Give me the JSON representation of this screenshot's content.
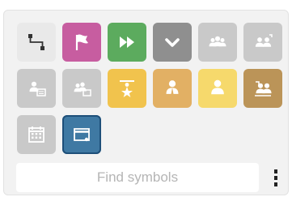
{
  "symbols": [
    {
      "name": "sequence-flow",
      "color": "#e9e9e9",
      "icon": "connector-icon"
    },
    {
      "name": "start-flag",
      "color": "#c75da0",
      "icon": "flag-icon"
    },
    {
      "name": "fast-forward",
      "color": "#5cab5e",
      "icon": "fast-forward-icon"
    },
    {
      "name": "decision",
      "color": "#8f8f8f",
      "icon": "chevron-down-icon"
    },
    {
      "name": "group",
      "color": "#c9c9c9",
      "icon": "users-icon"
    },
    {
      "name": "group-external",
      "color": "#c9c9c9",
      "icon": "users-external-icon"
    },
    {
      "name": "user-document",
      "color": "#c9c9c9",
      "icon": "user-document-icon"
    },
    {
      "name": "user-group-document",
      "color": "#c9c9c9",
      "icon": "user-group-document-icon"
    },
    {
      "name": "star-performer",
      "color": "#f1c34d",
      "icon": "star-person-icon"
    },
    {
      "name": "role",
      "color": "#e2b064",
      "icon": "person-icon"
    },
    {
      "name": "person",
      "color": "#f6d96c",
      "icon": "person-solid-icon"
    },
    {
      "name": "organization",
      "color": "#bb9458",
      "icon": "org-people-icon"
    },
    {
      "name": "calendar",
      "color": "#c9c9c9",
      "icon": "calendar-icon"
    },
    {
      "name": "window-event",
      "color": "#3f79a3",
      "icon": "window-icon"
    }
  ],
  "search": {
    "placeholder": "Find symbols"
  },
  "menu": {
    "icon": "more-vertical-icon"
  }
}
